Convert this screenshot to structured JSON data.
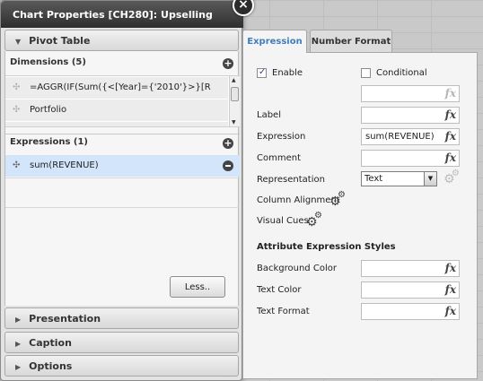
{
  "dialog": {
    "title": "Chart Properties [CH280]: Upselling"
  },
  "sections": {
    "pivot_table": "Pivot Table",
    "presentation": "Presentation",
    "caption": "Caption",
    "options": "Options"
  },
  "dimensions": {
    "header": "Dimensions (5)",
    "items": [
      "=AGGR(IF(Sum({<[Year]={'2010'}>}[R",
      "Portfolio"
    ]
  },
  "expressions": {
    "header": "Expressions (1)",
    "items": [
      "sum(REVENUE)"
    ]
  },
  "buttons": {
    "less": "Less.."
  },
  "tabs": {
    "expression": "Expression",
    "number_format": "Number Format"
  },
  "expression_tab": {
    "enable_label": "Enable",
    "enable_checked": true,
    "conditional_label": "Conditional",
    "conditional_checked": false,
    "conditional_value": "",
    "label_label": "Label",
    "label_value": "",
    "expression_label": "Expression",
    "expression_value": "sum(REVENUE)",
    "comment_label": "Comment",
    "comment_value": "",
    "representation_label": "Representation",
    "representation_value": "Text",
    "column_alignment_label": "Column Alignment",
    "visual_cues_label": "Visual Cues",
    "attr_styles_title": "Attribute Expression Styles",
    "background_color_label": "Background Color",
    "background_color_value": "",
    "text_color_label": "Text Color",
    "text_color_value": "",
    "text_format_label": "Text Format",
    "text_format_value": ""
  },
  "icons": {
    "fx": "fx",
    "close": "×",
    "plus": "+",
    "triangle_down": "▼",
    "triangle_right": "▶",
    "move": "✣",
    "gear": "⚙",
    "dropdown": "▼"
  },
  "colors": {
    "active_tab_text": "#3f7dbd",
    "selected_row": "#d3e5fb",
    "titlebar": "#3a3a3a"
  }
}
